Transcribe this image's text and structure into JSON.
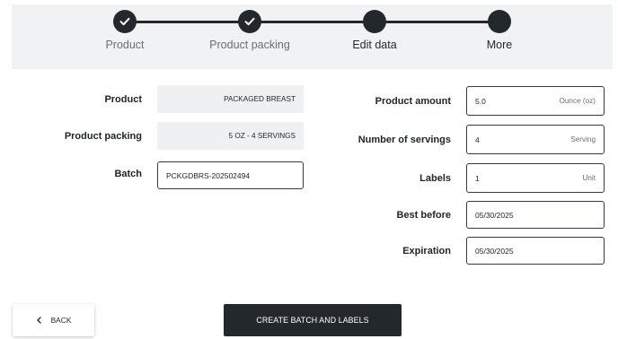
{
  "stepper": {
    "steps": [
      {
        "label": "Product",
        "state": "done"
      },
      {
        "label": "Product packing",
        "state": "done"
      },
      {
        "label": "Edit data",
        "state": "active"
      },
      {
        "label": "More",
        "state": "pending"
      }
    ]
  },
  "form": {
    "product": {
      "label": "Product",
      "value": "PACKAGED BREAST"
    },
    "product_packing": {
      "label": "Product packing",
      "value": "5 OZ - 4 SERVINGS"
    },
    "batch": {
      "label": "Batch",
      "value": "PCKGDBRS-202502494"
    },
    "product_amount": {
      "label": "Product amount",
      "value": "5.0",
      "unit": "Ounce (oz)"
    },
    "number_of_servings": {
      "label": "Number of servings",
      "value": "4",
      "unit": "Serving"
    },
    "labels": {
      "label": "Labels",
      "value": "1",
      "unit": "Unit"
    },
    "best_before": {
      "label": "Best before",
      "value": "05/30/2025"
    },
    "expiration": {
      "label": "Expiration",
      "value": "05/30/2025"
    }
  },
  "actions": {
    "back_label": "BACK",
    "create_label": "CREATE BATCH AND LABELS"
  },
  "colors": {
    "accent": "#23282d",
    "stepper_bg": "#f1f2f3",
    "readonly_bg": "#eef0f1"
  },
  "icons": {
    "step_done": "check-icon",
    "back": "chevron-left-icon"
  }
}
